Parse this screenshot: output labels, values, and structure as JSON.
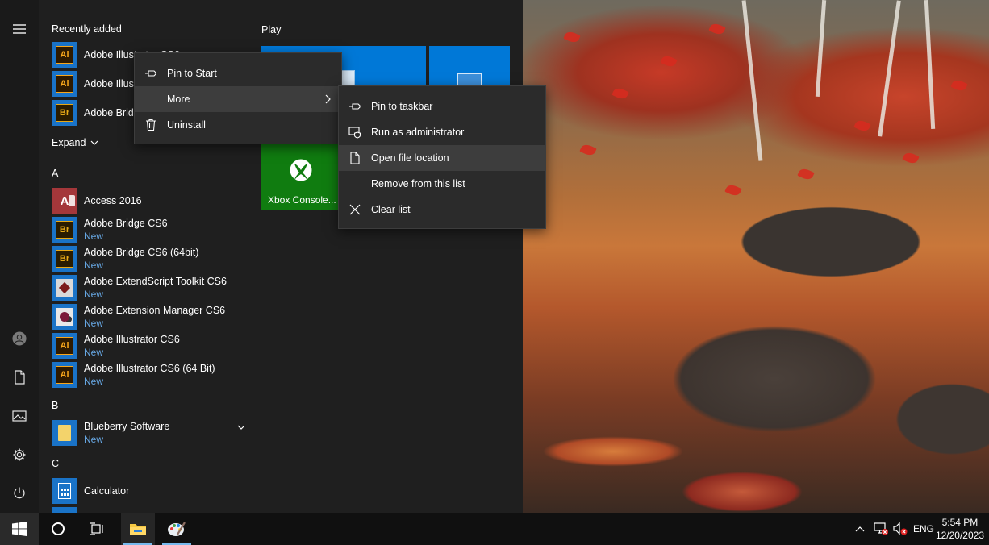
{
  "start_menu": {
    "recently_added_title": "Recently added",
    "recent": [
      {
        "label": "Adobe Illustrator CS6",
        "icon": "Ai"
      },
      {
        "label": "Adobe Illustrator CS6 (64 Bit)",
        "icon": "Ai"
      },
      {
        "label": "Adobe Bridge CS6",
        "icon": "Br"
      }
    ],
    "expand_label": "Expand",
    "letters": {
      "a": "A",
      "b": "B",
      "c": "C"
    },
    "apps": [
      {
        "label": "Access 2016",
        "badge": "",
        "icon": "A"
      },
      {
        "label": "Adobe Bridge CS6",
        "badge": "New",
        "icon": "Br"
      },
      {
        "label": "Adobe Bridge CS6 (64bit)",
        "badge": "New",
        "icon": "Br"
      },
      {
        "label": "Adobe ExtendScript Toolkit CS6",
        "badge": "New",
        "icon": "script"
      },
      {
        "label": "Adobe Extension Manager CS6",
        "badge": "New",
        "icon": "ext"
      },
      {
        "label": "Adobe Illustrator CS6",
        "badge": "New",
        "icon": "Ai"
      },
      {
        "label": "Adobe Illustrator CS6 (64 Bit)",
        "badge": "New",
        "icon": "Ai"
      },
      {
        "label": "Blueberry Software",
        "badge": "New",
        "icon": "folder"
      },
      {
        "label": "Calculator",
        "badge": "",
        "icon": "calculator"
      }
    ],
    "tiles_group_title": "Play",
    "xbox_tile_label": "Xbox Console..."
  },
  "context_menu": {
    "items": [
      {
        "label": "Pin to Start",
        "icon": "pin-icon"
      },
      {
        "label": "More",
        "icon": ""
      },
      {
        "label": "Uninstall",
        "icon": "trash-icon"
      }
    ]
  },
  "submenu": {
    "items": [
      {
        "label": "Pin to taskbar",
        "icon": "pin-icon"
      },
      {
        "label": "Run as administrator",
        "icon": "shield-icon"
      },
      {
        "label": "Open file location",
        "icon": "file-icon"
      },
      {
        "label": "Remove from this list",
        "icon": ""
      },
      {
        "label": "Clear list",
        "icon": "close-icon"
      }
    ],
    "highlighted_index": 2
  },
  "taskbar": {
    "language": "ENG",
    "time": "5:54 PM",
    "date": "12/20/2023"
  },
  "colors": {
    "accent": "#0078d7",
    "xbox_green": "#107c10",
    "new_badge": "#68a9e6",
    "adobe_ai": "#f7a61c",
    "adobe_br": "#e6a817",
    "access_red": "#a4373a"
  }
}
